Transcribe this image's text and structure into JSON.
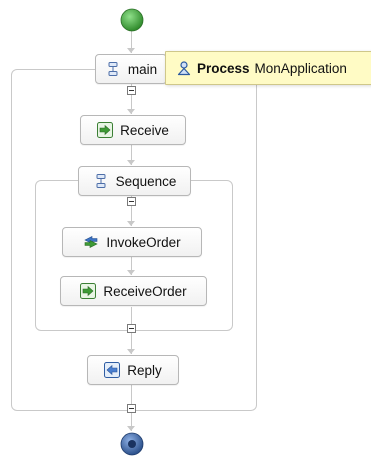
{
  "process": {
    "main": {
      "label": "main"
    },
    "scopes": [
      {
        "label": "Sequence"
      }
    ],
    "activities": [
      {
        "label": "Receive",
        "icon": "receive-arrow-icon"
      },
      {
        "label": "InvokeOrder",
        "icon": "invoke-arrows-icon"
      },
      {
        "label": "ReceiveOrder",
        "icon": "receive-arrow-icon"
      },
      {
        "label": "Reply",
        "icon": "reply-arrow-icon"
      }
    ],
    "start": {
      "icon": "start-node-icon",
      "color": "#3f9f3a"
    },
    "end": {
      "icon": "end-node-icon",
      "color": "#2a4f8a"
    }
  },
  "tooltip": {
    "icon": "process-person-icon",
    "keyword": "Process",
    "name": "MonApplication"
  }
}
